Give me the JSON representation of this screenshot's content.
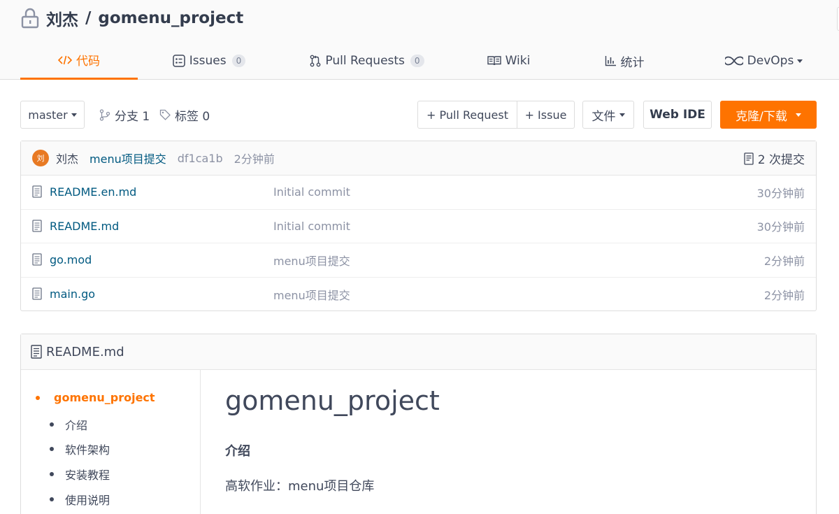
{
  "repo": {
    "owner": "刘杰",
    "separator": "/",
    "name": "gomenu_project"
  },
  "tabs": [
    {
      "label": "代码",
      "icon": "code-icon",
      "active": true
    },
    {
      "label": "Issues",
      "icon": "issues-icon",
      "badge": "0"
    },
    {
      "label": "Pull Requests",
      "icon": "pull-request-icon",
      "badge": "0"
    },
    {
      "label": "Wiki",
      "icon": "wiki-icon"
    },
    {
      "label": "统计",
      "icon": "chart-icon"
    },
    {
      "label": "DevOps",
      "icon": "infinity-icon"
    }
  ],
  "toolbar": {
    "branch": "master",
    "branches_label": "分支 1",
    "tags_label": "标签 0",
    "pull_request_label": "+ Pull Request",
    "issue_label": "+ Issue",
    "file_label": "文件",
    "web_ide_label": "Web IDE",
    "clone_label": "克隆/下载"
  },
  "last_commit": {
    "avatar_text": "刘",
    "author": "刘杰",
    "message": "menu项目提交",
    "sha": "df1ca1b",
    "time": "2分钟前",
    "count_label": "2 次提交"
  },
  "files": [
    {
      "name": "README.en.md",
      "message": "Initial commit",
      "time": "30分钟前"
    },
    {
      "name": "README.md",
      "message": "Initial commit",
      "time": "30分钟前"
    },
    {
      "name": "go.mod",
      "message": "menu项目提交",
      "time": "2分钟前"
    },
    {
      "name": "main.go",
      "message": "menu项目提交",
      "time": "2分钟前"
    }
  ],
  "readme": {
    "filename": "README.md",
    "toc": [
      "gomenu_project",
      "介绍",
      "软件架构",
      "安装教程",
      "使用说明"
    ],
    "title": "gomenu_project",
    "section_heading": "介绍",
    "intro_text": "高软作业：menu项目仓库"
  },
  "colors": {
    "accent": "#fe7300",
    "link": "#005980",
    "muted": "#8c92a4"
  }
}
